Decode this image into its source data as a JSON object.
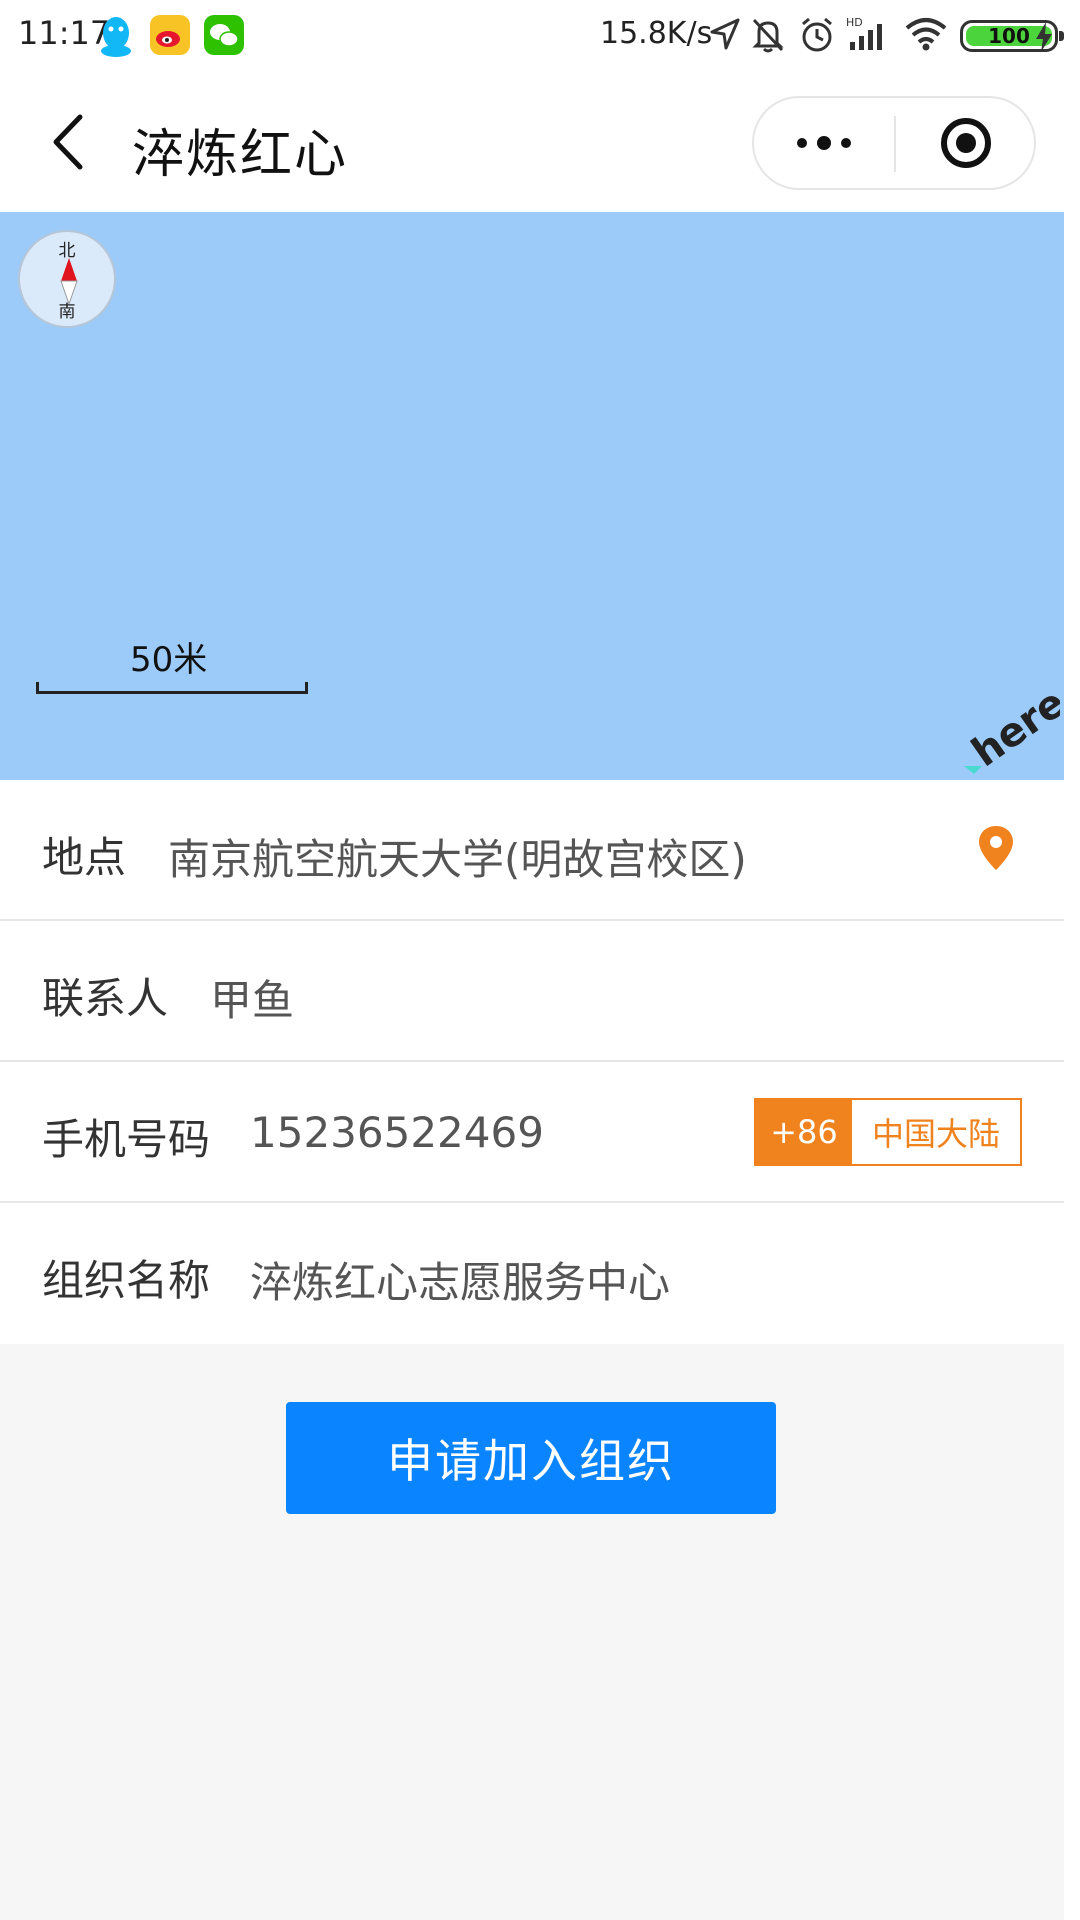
{
  "status_bar": {
    "time": "11:17",
    "network_speed": "15.8K/s",
    "battery_level": "100",
    "icons": [
      "qq-icon",
      "weibo-icon",
      "wechat-icon",
      "location-arrow-icon",
      "mute-icon",
      "alarm-icon",
      "signal-icon",
      "wifi-icon",
      "battery-icon",
      "charging-icon"
    ]
  },
  "nav": {
    "title": "淬炼红心",
    "back_icon": "chevron-left-icon",
    "more_icon": "more-dots-icon",
    "close_icon": "target-close-icon"
  },
  "map": {
    "compass_north": "北",
    "compass_south": "南",
    "scale_label": "50米",
    "provider_logo": "here",
    "background_color": "#9ccbfa"
  },
  "form": {
    "location": {
      "label": "地点",
      "value": "南京航空航天大学(明故宫校区)"
    },
    "contact": {
      "label": "联系人",
      "value": "甲鱼"
    },
    "phone": {
      "label": "手机号码",
      "value": "15236522469",
      "country_code": "+86",
      "region": "中国大陆"
    },
    "org": {
      "label": "组织名称",
      "value": "淬炼红心志愿服务中心"
    }
  },
  "actions": {
    "apply_label": "申请加入组织"
  },
  "colors": {
    "accent_orange": "#f0831e",
    "button_blue": "#0a84ff",
    "page_background": "#f6f6f6"
  }
}
